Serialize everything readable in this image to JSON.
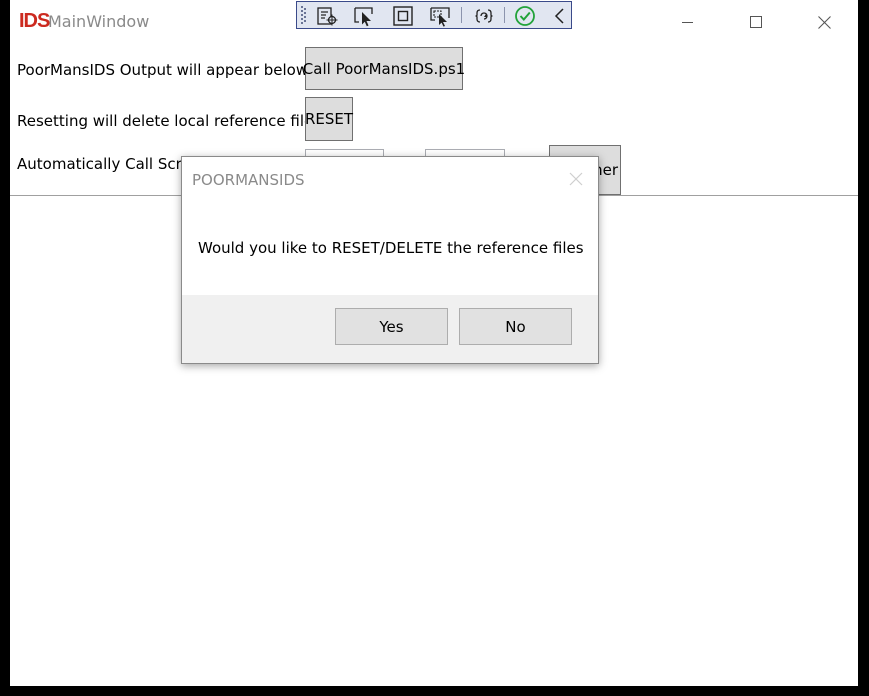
{
  "window": {
    "logo_text": "IDS",
    "title": "MainWindow"
  },
  "main": {
    "output_label": "PoorMansIDS Output will appear below",
    "call_button_label": "Call PoorMansIDS.ps1",
    "reset_label": "Resetting will delete local reference files",
    "reset_button_label": "RESET",
    "auto_label": "Automatically Call Scrip",
    "timer_button_label_visible": "ner"
  },
  "dialog": {
    "title": "POORMANSIDS",
    "message": "Would you like to RESET/DELETE the reference files",
    "yes_label": "Yes",
    "no_label": "No"
  },
  "colors": {
    "logo_red": "#cc2a1f",
    "toolbar_bg": "#e1e6f1",
    "check_green": "#22a33a"
  },
  "icons": {
    "toolbar": [
      "grip-icon",
      "live-visual-tree-icon",
      "select-element-icon",
      "display-layout-adorners-icon",
      "track-focused-element-icon",
      "hot-reload-icon",
      "binding-failures-ok-icon",
      "collapse-toolbar-icon"
    ],
    "window_controls": [
      "minimize-icon",
      "maximize-icon",
      "close-icon"
    ]
  }
}
